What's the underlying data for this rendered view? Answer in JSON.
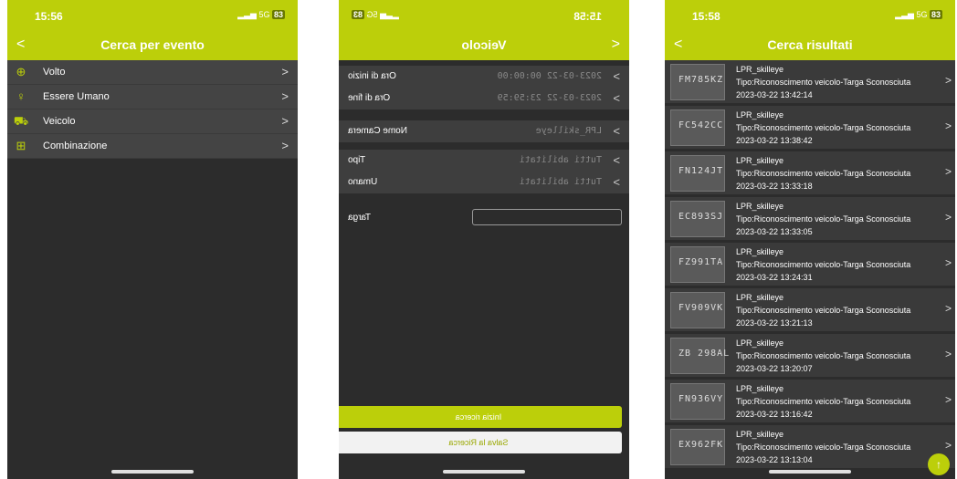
{
  "colors": {
    "accent": "#bccf0a",
    "panel_bg": "#2c2c2c",
    "list_bg": "#444444"
  },
  "panel1": {
    "status": {
      "time": "15:56",
      "signal": "5G",
      "battery": "83"
    },
    "title": "Cerca per evento",
    "items": [
      {
        "label": "Volto",
        "icon": "face-icon"
      },
      {
        "label": "Essere Umano",
        "icon": "person-icon"
      },
      {
        "label": "Veicolo",
        "icon": "car-icon"
      },
      {
        "label": "Combinazione",
        "icon": "combination-icon"
      }
    ]
  },
  "panel2": {
    "status": {
      "time": "15:58",
      "signal": "5G",
      "battery": "83"
    },
    "title": "Veicolo",
    "rows": {
      "start_label": "Ora di inizio",
      "start_value": "2023-03-22 00:00:00",
      "end_label": "Ora di fine",
      "end_value": "2023-03-22 23:59:59",
      "camera_label": "Nome Camera",
      "camera_value": "LPR_skilleye",
      "type_label": "Tipo",
      "type_value": "Tutti abilitati",
      "human_label": "Umano",
      "human_value": "Tutti abilitati"
    },
    "plate_label": "Targa",
    "plate_value": "",
    "start_button": "Inizia ricerca",
    "save_button": "Salva la Ricerca"
  },
  "panel3": {
    "status": {
      "time": "15:58",
      "signal": "5G",
      "battery": "83"
    },
    "title": "Cerca risultati",
    "results": [
      {
        "camera": "LPR_skilleye",
        "type": "Tipo:Riconoscimento veicolo-Targa Sconosciuta",
        "time": "2023-03-22 13:42:14",
        "plate": "FM785KZ"
      },
      {
        "camera": "LPR_skilleye",
        "type": "Tipo:Riconoscimento veicolo-Targa Sconosciuta",
        "time": "2023-03-22 13:38:42",
        "plate": "FC542CC"
      },
      {
        "camera": "LPR_skilleye",
        "type": "Tipo:Riconoscimento veicolo-Targa Sconosciuta",
        "time": "2023-03-22 13:33:18",
        "plate": "FN124JT"
      },
      {
        "camera": "LPR_skilleye",
        "type": "Tipo:Riconoscimento veicolo-Targa Sconosciuta",
        "time": "2023-03-22 13:33:05",
        "plate": "EC893SJ"
      },
      {
        "camera": "LPR_skilleye",
        "type": "Tipo:Riconoscimento veicolo-Targa Sconosciuta",
        "time": "2023-03-22 13:24:31",
        "plate": "FZ991TA"
      },
      {
        "camera": "LPR_skilleye",
        "type": "Tipo:Riconoscimento veicolo-Targa Sconosciuta",
        "time": "2023-03-22 13:21:13",
        "plate": "FV909VK"
      },
      {
        "camera": "LPR_skilleye",
        "type": "Tipo:Riconoscimento veicolo-Targa Sconosciuta",
        "time": "2023-03-22 13:20:07",
        "plate": "ZB 298AL"
      },
      {
        "camera": "LPR_skilleye",
        "type": "Tipo:Riconoscimento veicolo-Targa Sconosciuta",
        "time": "2023-03-22 13:16:42",
        "plate": "FN936VY"
      },
      {
        "camera": "LPR_skilleye",
        "type": "Tipo:Riconoscimento veicolo-Targa Sconosciuta",
        "time": "2023-03-22 13:13:04",
        "plate": "EX962FK"
      }
    ]
  }
}
